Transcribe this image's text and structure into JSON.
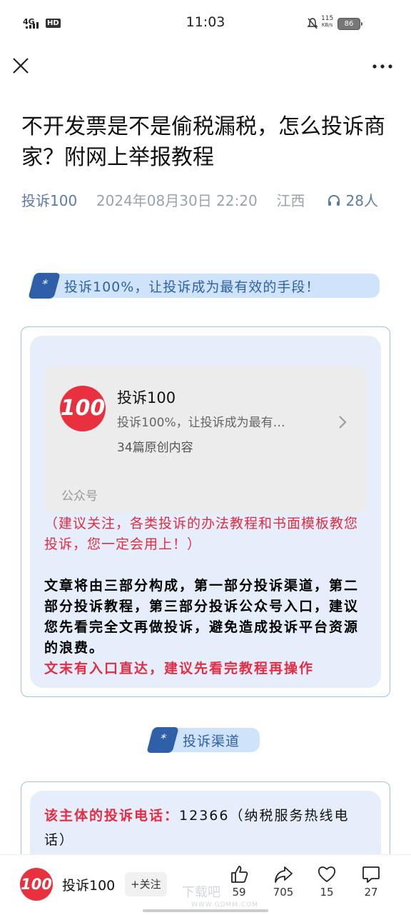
{
  "status_bar": {
    "network": "4G",
    "hd": "HD",
    "time": "11:03",
    "net_speed_value": "115",
    "net_speed_unit": "KB/s",
    "battery": "86"
  },
  "article": {
    "title": "不开发票是不是偷税漏税，怎么投诉商家？附网上举报教程",
    "author": "投诉100",
    "datetime": "2024年08月30日 22:20",
    "location": "江西",
    "listeners": "28人"
  },
  "banner1": {
    "tag": "*",
    "text": "投诉100%，让投诉成为最有效的手段！"
  },
  "account_card": {
    "logo_text": "100",
    "name": "投诉100",
    "description": "投诉100%，让投诉成为最有…",
    "count": "34篇原创内容",
    "type": "公众号"
  },
  "notes": {
    "red_note": "（建议关注，各类投诉的办法教程和书面模板教您投诉，您一定会用上！）",
    "intro": "文章将由三部分构成，第一部分投诉渠道，第二部分投诉教程，第三部分投诉公众号入口，建议您先看完全文再做投诉，避免造成投诉平台资源的浪费。",
    "tip": "文末有入口直达，建议先看完教程再操作"
  },
  "banner2": {
    "tag": "*",
    "text": "投诉渠道"
  },
  "channel": {
    "label": "该主体的投诉电话：",
    "value": "12366（纳税服务热线电话）"
  },
  "bottom_bar": {
    "author": "投诉100",
    "follow_label": "+关注",
    "likes": "59",
    "shares": "705",
    "favorites": "15",
    "comments": "27"
  },
  "watermark": {
    "text": "下载吧",
    "url": "WWW.GDMM.COM"
  },
  "colors": {
    "accent_blue": "#2f5fa8",
    "brand_red": "#e8303f",
    "note_red": "#e52c42"
  }
}
